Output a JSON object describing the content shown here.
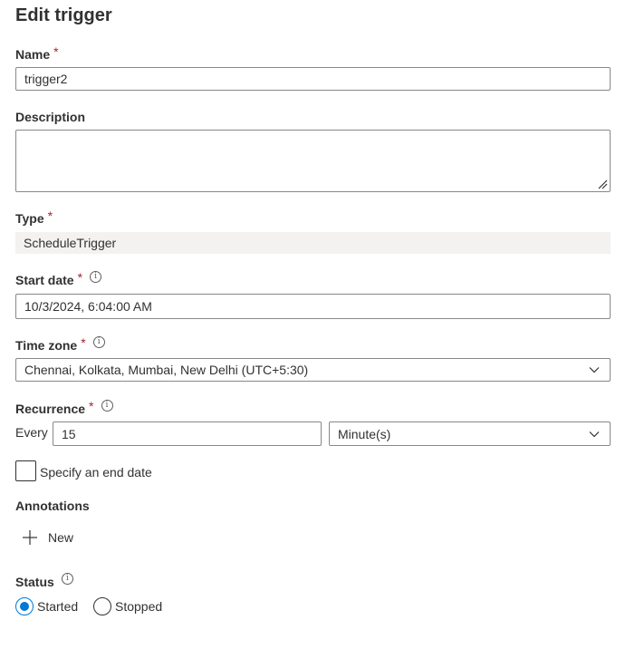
{
  "panel": {
    "title": "Edit trigger"
  },
  "required_mark": "*",
  "info_glyph": "i",
  "name_field": {
    "label": "Name",
    "value": "trigger2"
  },
  "description_field": {
    "label": "Description",
    "value": ""
  },
  "type_field": {
    "label": "Type",
    "value": "ScheduleTrigger"
  },
  "start_date_field": {
    "label": "Start date",
    "value": "10/3/2024, 6:04:00 AM"
  },
  "time_zone_field": {
    "label": "Time zone",
    "value": "Chennai, Kolkata, Mumbai, New Delhi (UTC+5:30)"
  },
  "recurrence_field": {
    "label": "Recurrence",
    "every_label": "Every",
    "interval_value": "15",
    "unit_value": "Minute(s)"
  },
  "end_date_checkbox": {
    "label": "Specify an end date",
    "checked": false
  },
  "annotations": {
    "label": "Annotations",
    "new_label": "New"
  },
  "status": {
    "label": "Status",
    "options": [
      {
        "label": "Started",
        "selected": true
      },
      {
        "label": "Stopped",
        "selected": false
      }
    ]
  },
  "colors": {
    "accent": "#0078d4",
    "required": "#a4262c",
    "border": "#8a8886",
    "readonly_bg": "#f3f2f1",
    "text": "#323130"
  },
  "icons": {
    "info": "info-icon",
    "chevron": "chevron-down-icon",
    "plus": "plus-icon",
    "resize": "resize-grip-icon"
  }
}
